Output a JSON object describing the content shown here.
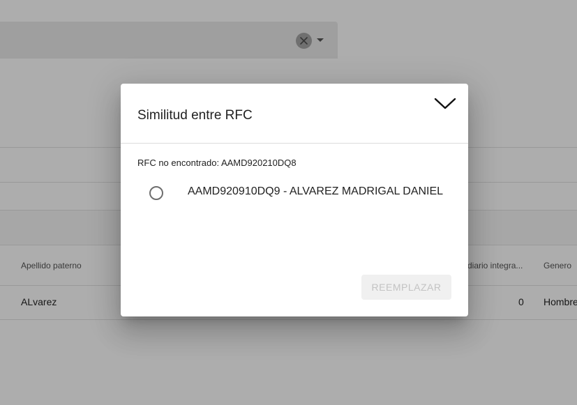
{
  "background": {
    "table": {
      "headers": {
        "apellido_paterno": "Apellido paterno",
        "salario_diario": "diario integra...",
        "genero": "Genero"
      },
      "row": {
        "apellido_paterno": "ALvarez",
        "salario_diario": "0",
        "genero": "Hombre"
      }
    }
  },
  "dialog": {
    "title": "Similitud entre RFC",
    "not_found_text": "RFC no encontrado: AAMD920210DQ8",
    "options": [
      {
        "label": "AAMD920910DQ9 - ALVAREZ MADRIGAL DANIEL",
        "selected": false
      }
    ],
    "replace_button": "REEMPLAZAR",
    "replace_button_disabled": true
  },
  "icons": {
    "clear": "close-icon",
    "dropdown": "arrow-drop-down-icon",
    "collapse": "chevron-down-icon"
  },
  "colors": {
    "backdrop": "rgba(0,0,0,0.32)",
    "dialog_bg": "#ffffff",
    "disabled_button_bg": "#f0f0f0",
    "disabled_button_text": "#c3c3c3"
  }
}
